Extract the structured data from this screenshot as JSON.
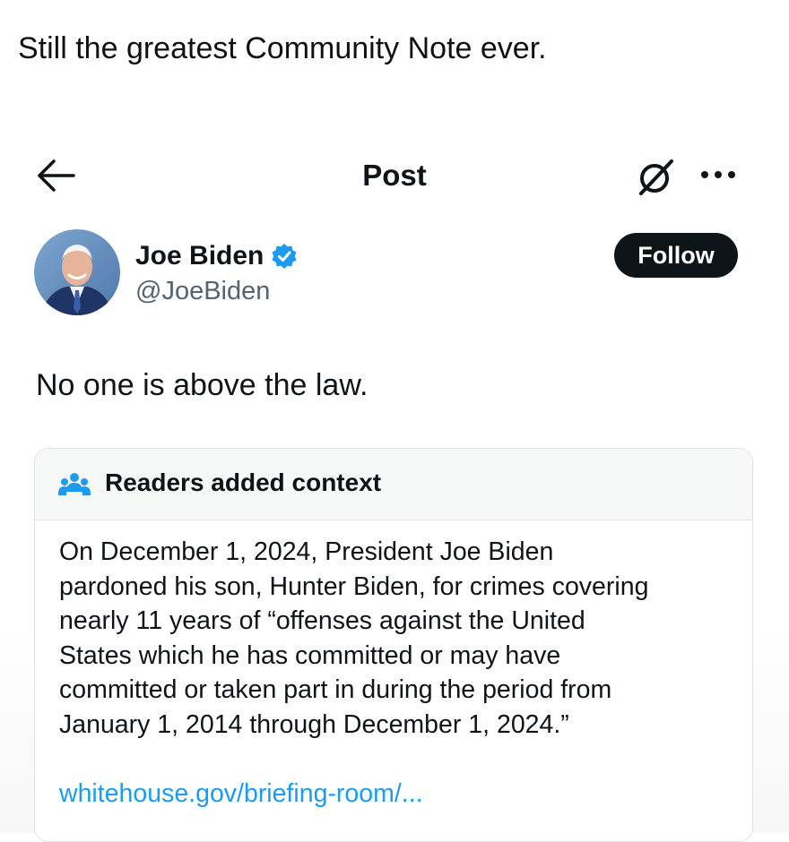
{
  "caption": "Still the greatest Community Note ever.",
  "header": {
    "title": "Post",
    "back_icon": "arrow-left-icon",
    "grok_icon": "grok-icon",
    "more_icon": "more-horizontal-icon"
  },
  "author": {
    "name": "Joe Biden",
    "handle": "@JoeBiden",
    "verified_icon": "verified-badge-icon",
    "follow_label": "Follow"
  },
  "post": {
    "text": "No one is above the law."
  },
  "community_note": {
    "header_icon": "readers-group-icon",
    "title": "Readers added context",
    "body_lines": [
      "On December 1, 2024, President Joe Biden",
      "pardoned his son, Hunter Biden, for crimes covering",
      "nearly 11 years of “offenses against the United",
      "States which he has committed or may have",
      "committed or taken part in during the period from",
      "January 1, 2014 through December 1, 2024.”"
    ],
    "link": "whitehouse.gov/briefing-room/..."
  },
  "colors": {
    "text_primary": "#0f1419",
    "text_secondary": "#536471",
    "link": "#1d9bf0",
    "verified": "#1d9bf0",
    "follow_bg": "#0f1419"
  }
}
